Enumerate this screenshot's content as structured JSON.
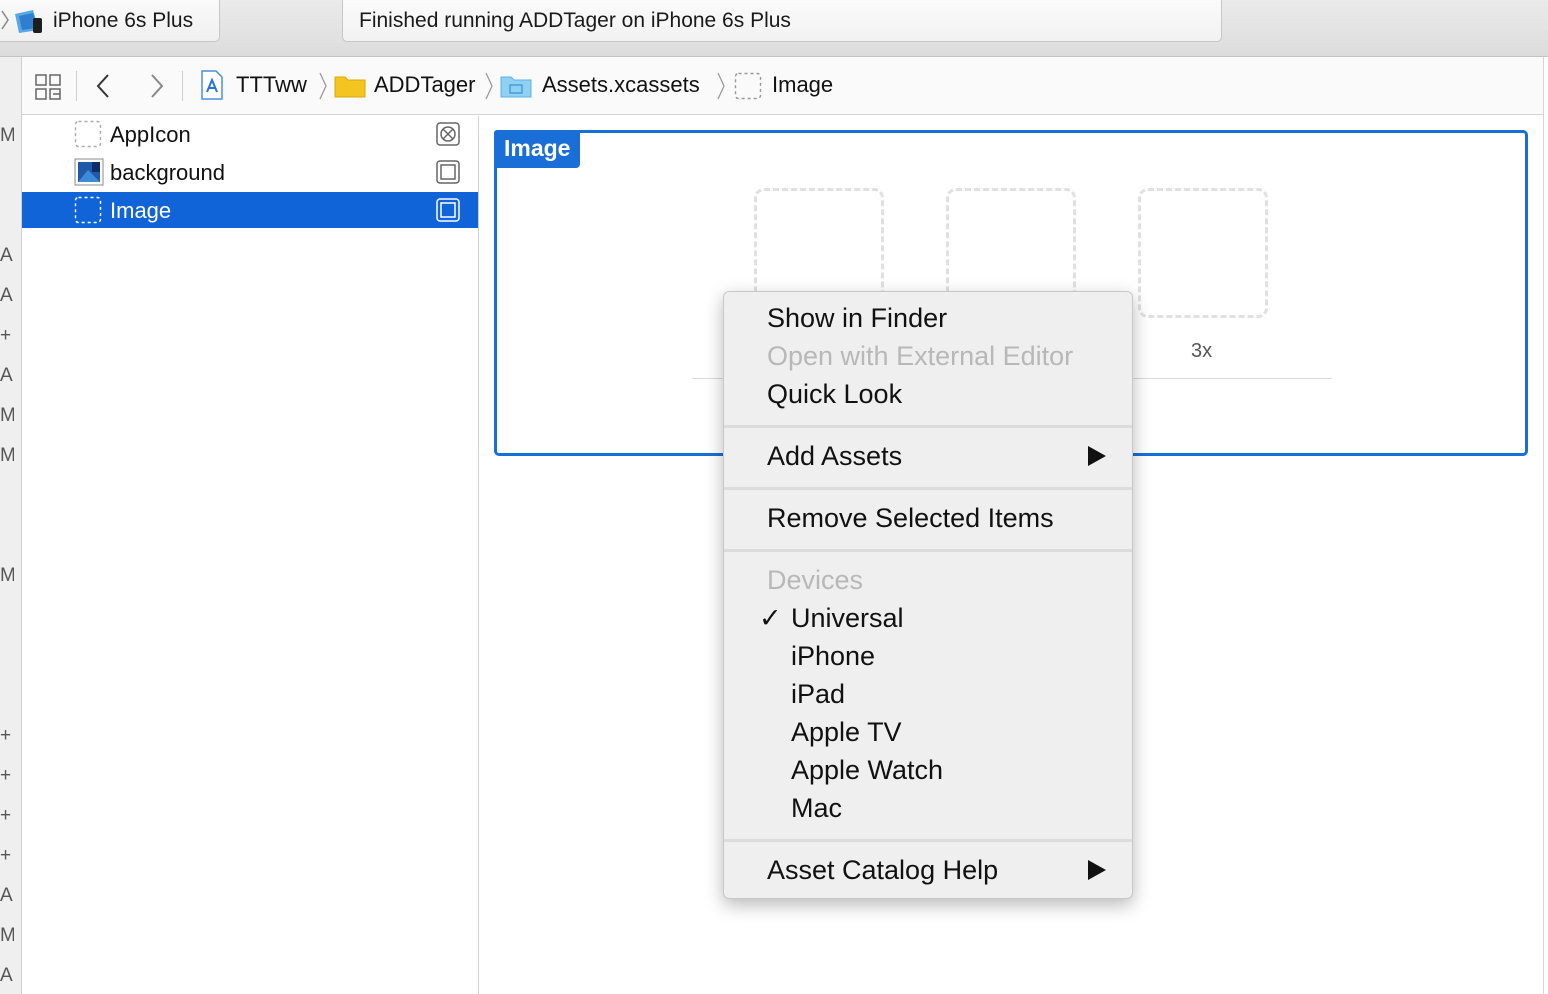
{
  "toolbar": {
    "scheme_device": "iPhone 6s Plus",
    "status": "Finished running ADDTager on iPhone 6s Plus"
  },
  "jumpbar": {
    "path": [
      "TTTww",
      "ADDTager",
      "Assets.xcassets",
      "Image"
    ]
  },
  "left_strip": {
    "glyphs": [
      "M",
      "A",
      "A",
      "+",
      "A",
      "M",
      "M",
      "M",
      "+",
      "+",
      "+",
      "+",
      "A",
      "M",
      "A"
    ]
  },
  "assets": [
    {
      "name": "AppIcon",
      "selected": false,
      "icon": "appicon-placeholder-icon"
    },
    {
      "name": "background",
      "selected": false,
      "icon": "image-thumbnail-icon"
    },
    {
      "name": "Image",
      "selected": true,
      "icon": "imageset-placeholder-icon"
    }
  ],
  "image_set": {
    "title": "Image",
    "slot_label_3x": "3x"
  },
  "context_menu": {
    "show_in_finder": "Show in Finder",
    "open_external": "Open with External Editor",
    "quick_look": "Quick Look",
    "add_assets": "Add Assets",
    "remove_selected": "Remove Selected Items",
    "devices_header": "Devices",
    "check_mark": "✓",
    "devices": [
      "Universal",
      "iPhone",
      "iPad",
      "Apple TV",
      "Apple Watch",
      "Mac"
    ],
    "checked_device": "Universal",
    "help": "Asset Catalog Help"
  },
  "colors": {
    "selection": "#1064d8",
    "accent": "#1a6ed8"
  }
}
